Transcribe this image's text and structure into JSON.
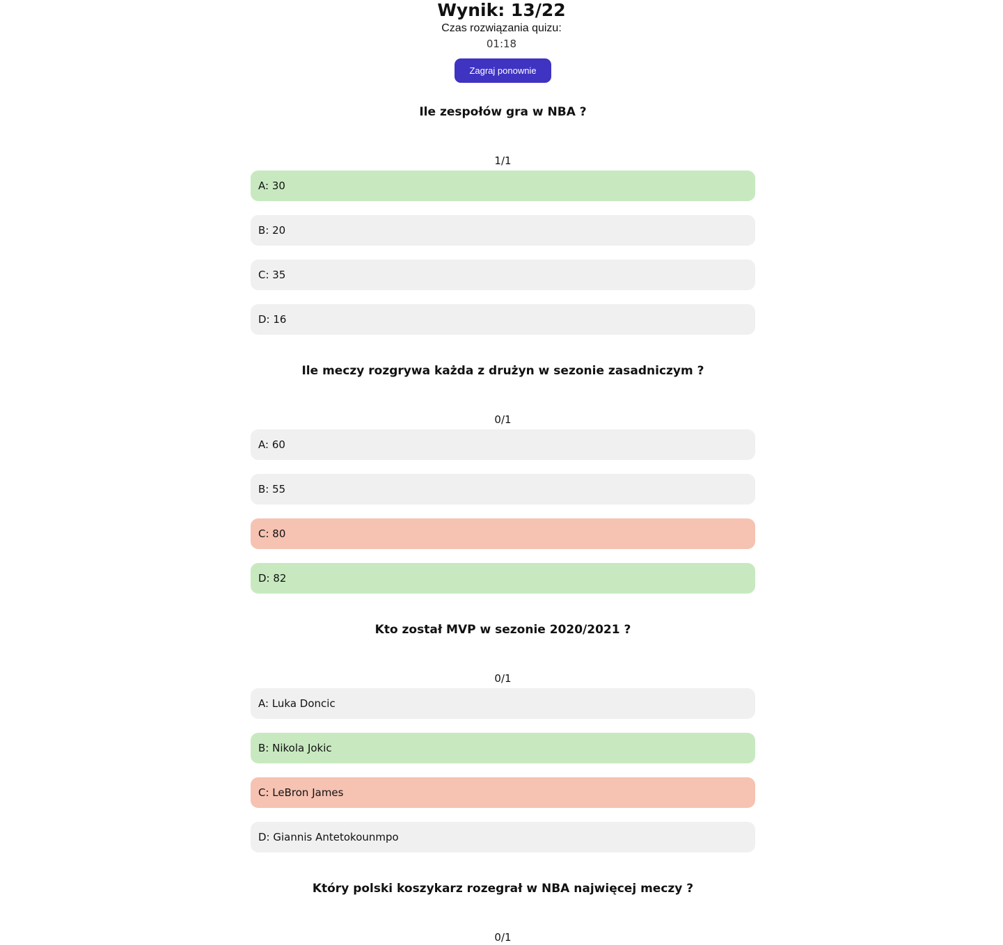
{
  "result": {
    "score_text": "Wynik: 13/22",
    "time_label": "Czas rozwiązania quizu:",
    "time_value": "01:18",
    "play_again_label": "Zagraj ponownie"
  },
  "colors": {
    "accent": "#3f33c2",
    "correct": "#c8e9c0",
    "wrong": "#f6c2b2",
    "neutral": "#f0f0f0"
  },
  "questions": [
    {
      "title": "Ile zespołów gra w NBA ?",
      "points": "1/1",
      "answers": [
        {
          "label": "A: 30",
          "status": "correct"
        },
        {
          "label": "B: 20",
          "status": "neutral"
        },
        {
          "label": "C: 35",
          "status": "neutral"
        },
        {
          "label": "D: 16",
          "status": "neutral"
        }
      ]
    },
    {
      "title": "Ile meczy rozgrywa każda z drużyn w sezonie zasadniczym ?",
      "points": "0/1",
      "answers": [
        {
          "label": "A: 60",
          "status": "neutral"
        },
        {
          "label": "B: 55",
          "status": "neutral"
        },
        {
          "label": "C: 80",
          "status": "wrong"
        },
        {
          "label": "D: 82",
          "status": "correct"
        }
      ]
    },
    {
      "title": "Kto został MVP w sezonie 2020/2021 ?",
      "points": "0/1",
      "answers": [
        {
          "label": "A: Luka Doncic",
          "status": "neutral"
        },
        {
          "label": "B: Nikola Jokic",
          "status": "correct"
        },
        {
          "label": "C: LeBron James",
          "status": "wrong"
        },
        {
          "label": "D: Giannis Antetokounmpo",
          "status": "neutral"
        }
      ]
    },
    {
      "title": "Który polski koszykarz rozegrał w NBA najwięcej meczy ?",
      "points": "0/1",
      "answers": []
    }
  ]
}
